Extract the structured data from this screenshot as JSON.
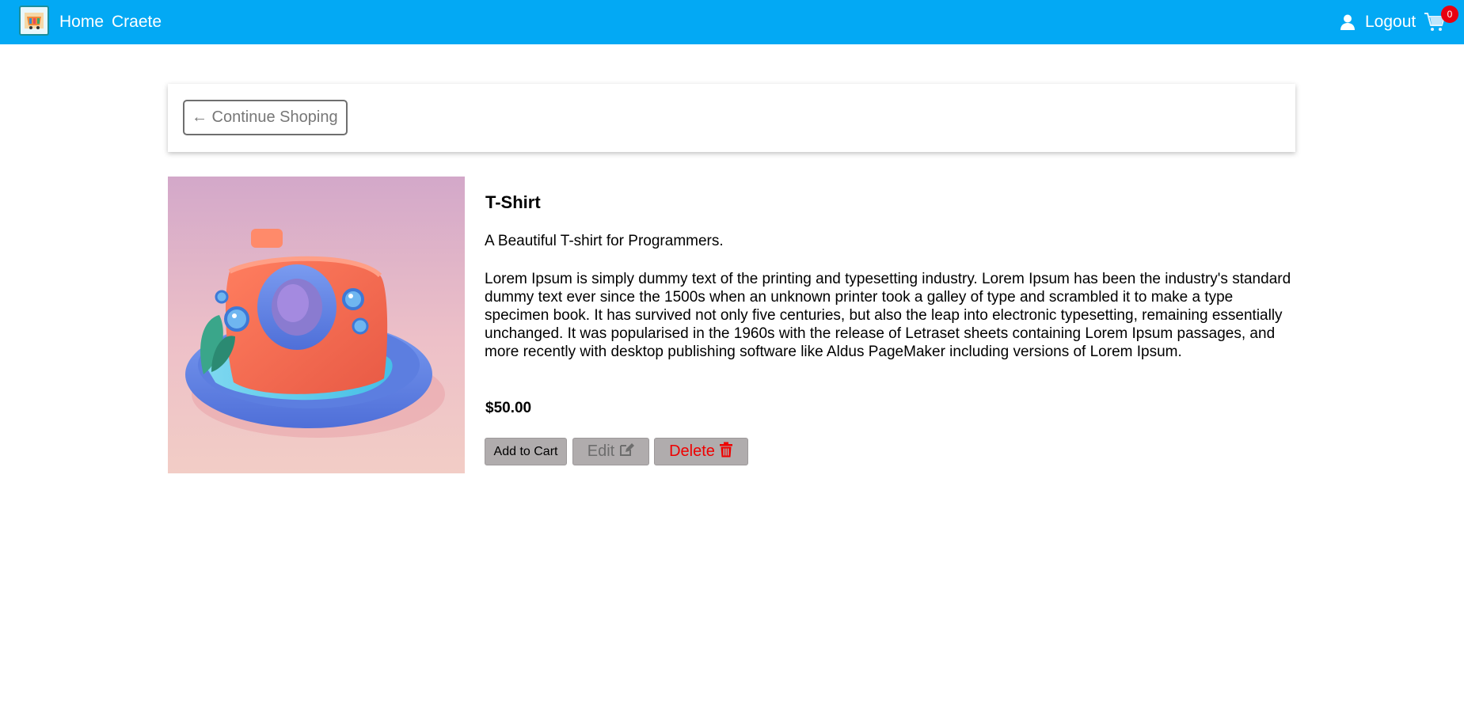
{
  "nav": {
    "home_label": "Home",
    "create_label": "Craete",
    "logout_label": "Logout",
    "cart_count": "0"
  },
  "back": {
    "label": "← Continue Shoping"
  },
  "product": {
    "title": "T-Shirt",
    "subtitle": "A Beautiful T-shirt for Programmers.",
    "description": "Lorem Ipsum is simply dummy text of the printing and typesetting industry. Lorem Ipsum has been the industry's standard dummy text ever since the 1500s when an unknown printer took a galley of type and scrambled it to make a type specimen book. It has survived not only five centuries, but also the leap into electronic typesetting, remaining essentially unchanged. It was popularised in the 1960s with the release of Letraset sheets containing Lorem Ipsum passages, and more recently with desktop publishing software like Aldus PageMaker including versions of Lorem Ipsum.",
    "price": "$50.00",
    "image": "3d-camera-illustration"
  },
  "actions": {
    "add_to_cart": "Add to Cart",
    "edit": "Edit",
    "delete": "Delete"
  },
  "colors": {
    "navbar": "#03a9f4",
    "delete_text": "#ef0000",
    "button_bg": "#b0acad",
    "badge": "#e8000f"
  },
  "icons": {
    "logo": "shop-logo-icon",
    "user": "user-icon",
    "cart": "cart-icon",
    "edit": "edit-icon",
    "delete": "trash-icon"
  }
}
